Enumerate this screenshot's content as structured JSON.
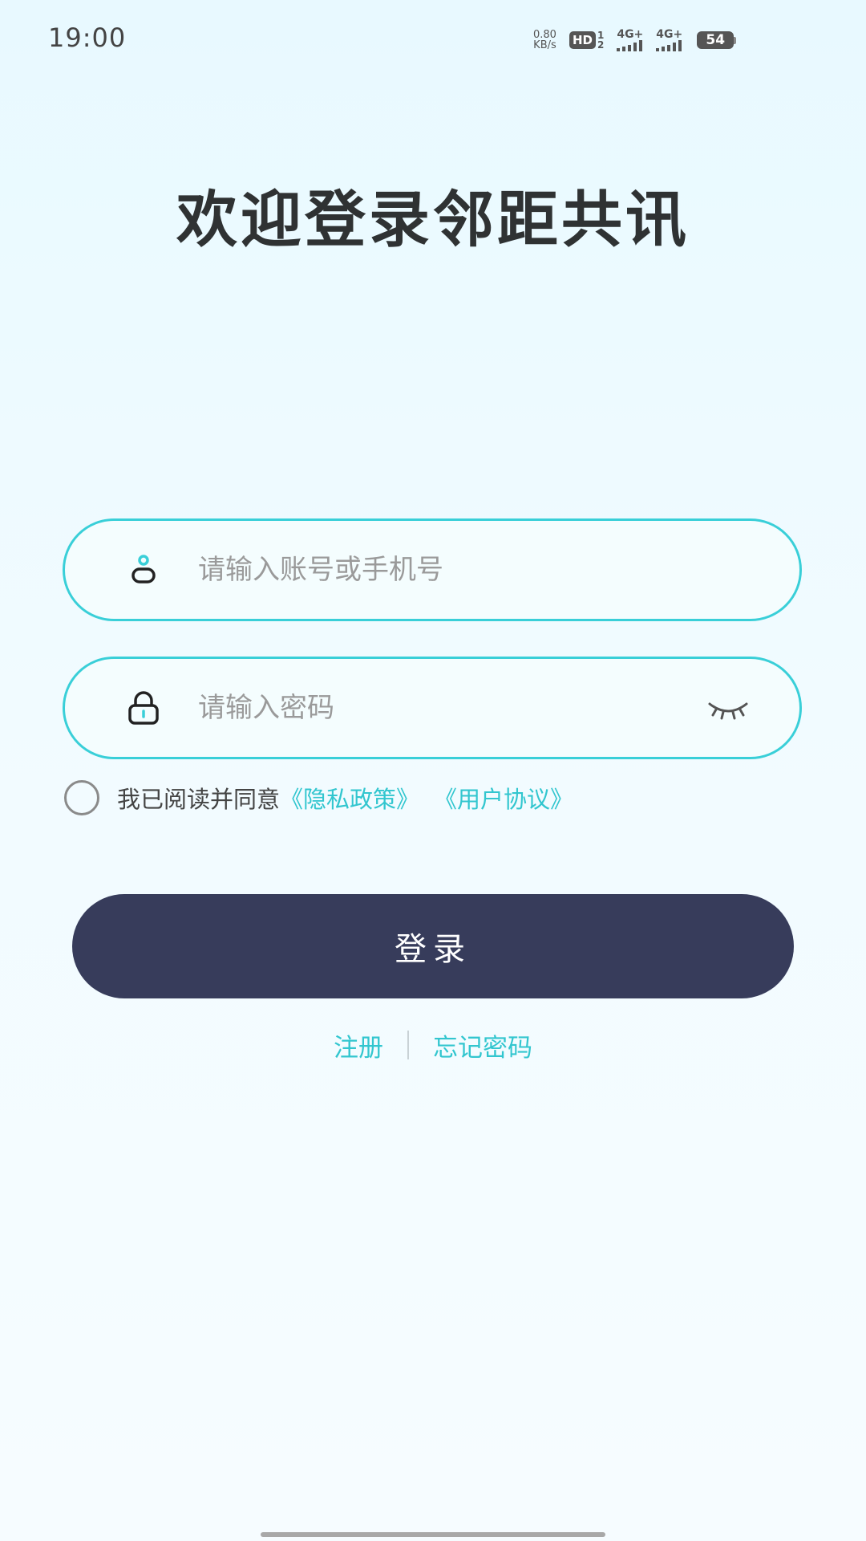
{
  "status_bar": {
    "time": "19:00",
    "net_speed_value": "0.80",
    "net_speed_unit": "KB/s",
    "hd_label": "HD",
    "hd_sim_top": "1",
    "hd_sim_bottom": "2",
    "signal_1_label": "4G+",
    "signal_2_label": "4G+",
    "battery_level": "54"
  },
  "title": "欢迎登录邻距共讯",
  "account_field": {
    "value": "",
    "placeholder": "请输入账号或手机号",
    "icon": "user-icon"
  },
  "password_field": {
    "value": "",
    "placeholder": "请输入密码",
    "icon": "lock-icon",
    "toggle_icon": "eye-closed-icon"
  },
  "agreement": {
    "checked": false,
    "text": "我已阅读并同意",
    "privacy_link": "《隐私政策》",
    "user_agreement_link": "《用户协议》"
  },
  "login_button": "登录",
  "links": {
    "register": "注册",
    "forgot_password": "忘记密码"
  },
  "colors": {
    "accent": "#32c6cf",
    "field_border": "#39cfd8",
    "button": "#373c5b",
    "title": "#2f3233"
  }
}
